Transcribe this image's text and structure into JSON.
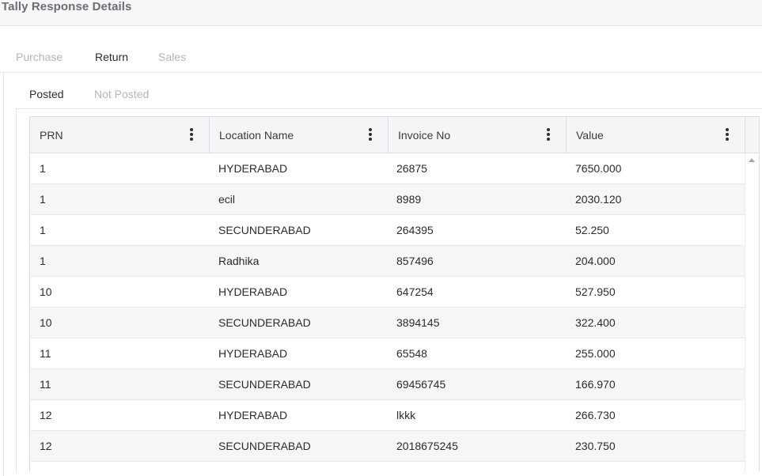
{
  "page": {
    "title": "Tally Response Details"
  },
  "tabs": [
    "Purchase",
    "Return",
    "Sales"
  ],
  "active_tab": "Return",
  "subtabs": [
    "Posted",
    "Not Posted"
  ],
  "active_subtab": "Posted",
  "table": {
    "columns": [
      "PRN",
      "Location Name",
      "Invoice No",
      "Value"
    ],
    "rows": [
      [
        "1",
        "HYDERABAD",
        "26875",
        "7650.000"
      ],
      [
        "1",
        "ecil",
        "8989",
        "2030.120"
      ],
      [
        "1",
        "SECUNDERABAD",
        "264395",
        "52.250"
      ],
      [
        "1",
        "Radhika",
        "857496",
        "204.000"
      ],
      [
        "10",
        "HYDERABAD",
        "647254",
        "527.950"
      ],
      [
        "10",
        "SECUNDERABAD",
        "3894145",
        "322.400"
      ],
      [
        "11",
        "HYDERABAD",
        "65548",
        "255.000"
      ],
      [
        "11",
        "SECUNDERABAD",
        "69456745",
        "166.970"
      ],
      [
        "12",
        "HYDERABAD",
        "lkkk",
        "266.730"
      ],
      [
        "12",
        "SECUNDERABAD",
        "2018675245",
        "230.750"
      ]
    ]
  }
}
